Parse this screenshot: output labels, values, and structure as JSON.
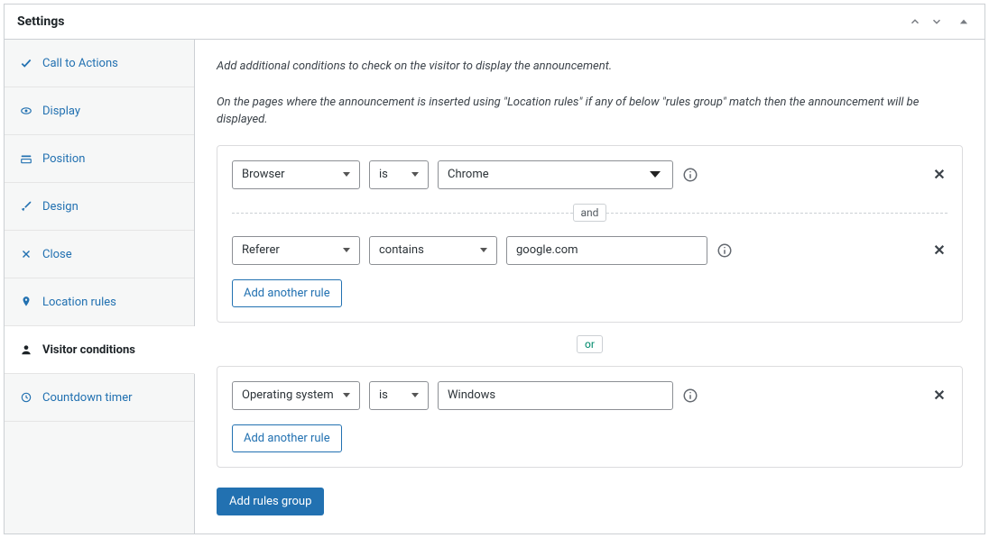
{
  "header": {
    "title": "Settings"
  },
  "sidebar": {
    "items": [
      {
        "label": "Call to Actions"
      },
      {
        "label": "Display"
      },
      {
        "label": "Position"
      },
      {
        "label": "Design"
      },
      {
        "label": "Close"
      },
      {
        "label": "Location rules"
      },
      {
        "label": "Visitor conditions"
      },
      {
        "label": "Countdown timer"
      }
    ]
  },
  "intro": {
    "line1": "Add additional conditions to check on the visitor to display the announcement.",
    "line2": "On the pages where the announcement is inserted using \"Location rules\" if any of below \"rules group\" match then the announcement will be displayed."
  },
  "groups": [
    {
      "rules": [
        {
          "field": "Browser",
          "operator": "is",
          "value": "Chrome",
          "value_is_select": true,
          "operator_select_width": "xs"
        },
        {
          "field": "Referer",
          "operator": "contains",
          "value": "google.com",
          "value_is_select": false,
          "operator_select_width": "med"
        }
      ],
      "add_rule_label": "Add another rule"
    },
    {
      "rules": [
        {
          "field": "Operating system",
          "operator": "is",
          "value": "Windows",
          "value_is_select": false,
          "operator_select_width": "xs"
        }
      ],
      "add_rule_label": "Add another rule"
    }
  ],
  "labels": {
    "and": "and",
    "or": "or",
    "add_group": "Add rules group"
  }
}
